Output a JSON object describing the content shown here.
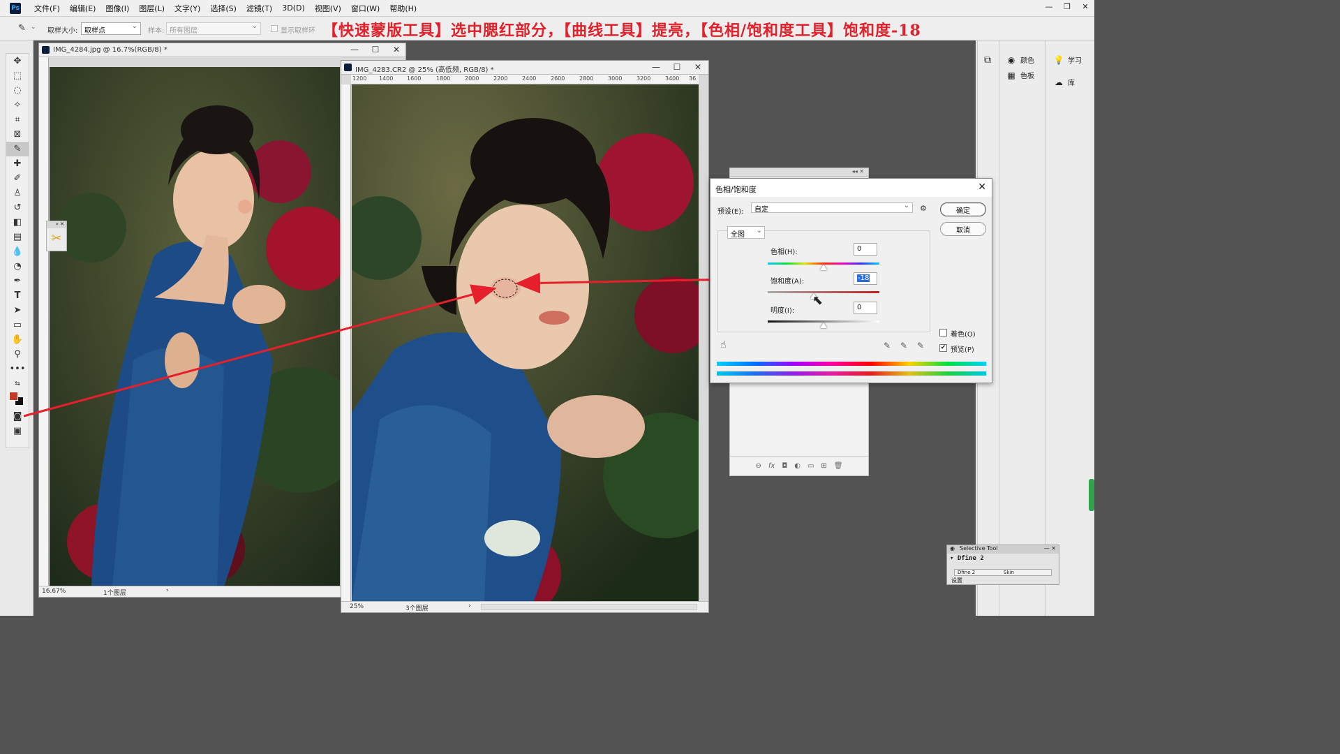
{
  "menubar": {
    "logo": "Ps",
    "items": [
      "文件(F)",
      "编辑(E)",
      "图像(I)",
      "图层(L)",
      "文字(Y)",
      "选择(S)",
      "滤镜(T)",
      "3D(D)",
      "视图(V)",
      "窗口(W)",
      "帮助(H)"
    ]
  },
  "options": {
    "sample_size_label": "取样大小:",
    "sample_size_value": "取样点",
    "sample_label": "样本:",
    "sample_value": "所有图层",
    "show_ring_label": "显示取样环"
  },
  "caption": "【快速蒙版工具】选中腮红部分，【曲线工具】提亮，【色相/饱和度工具】饱和度-18",
  "doc1": {
    "title": "IMG_4284.jpg @ 16.7%(RGB/8) *",
    "zoom": "16.67%",
    "layers": "1个图层"
  },
  "doc2": {
    "title": "IMG_4283.CR2 @ 25% (高低频, RGB/8) *",
    "zoom": "25%",
    "layers": "3个图层",
    "ruler": [
      "1200",
      "1400",
      "1600",
      "1800",
      "2000",
      "2200",
      "2400",
      "2600",
      "2800",
      "3000",
      "3200",
      "3400",
      "36"
    ]
  },
  "dialog": {
    "title": "色相/饱和度",
    "preset_label": "预设(E):",
    "preset_value": "自定",
    "channel": "全图",
    "hue_label": "色相(H):",
    "hue_value": "0",
    "saturation_label": "饱和度(A):",
    "saturation_value": "-18",
    "lightness_label": "明度(I):",
    "lightness_value": "0",
    "ok": "确定",
    "cancel": "取消",
    "colorize_label": "着色(O)",
    "colorize_checked": false,
    "preview_label": "预览(P)",
    "preview_checked": true,
    "hue_range": [
      -180,
      180
    ],
    "saturation_range": [
      -100,
      100
    ],
    "lightness_range": [
      -100,
      100
    ]
  },
  "panels": {
    "color": "颜色",
    "swatches": "色板",
    "learn": "学习",
    "library": "库"
  },
  "selective": {
    "title": "Selective Tool",
    "name": "Dfine 2",
    "row1": "Dfine 2",
    "row2": "Skin",
    "settings": "设置"
  },
  "colors": {
    "foreground": "#c43a26",
    "background": "#111111",
    "caption": "#e0202a",
    "arrow": "#e5202c"
  }
}
